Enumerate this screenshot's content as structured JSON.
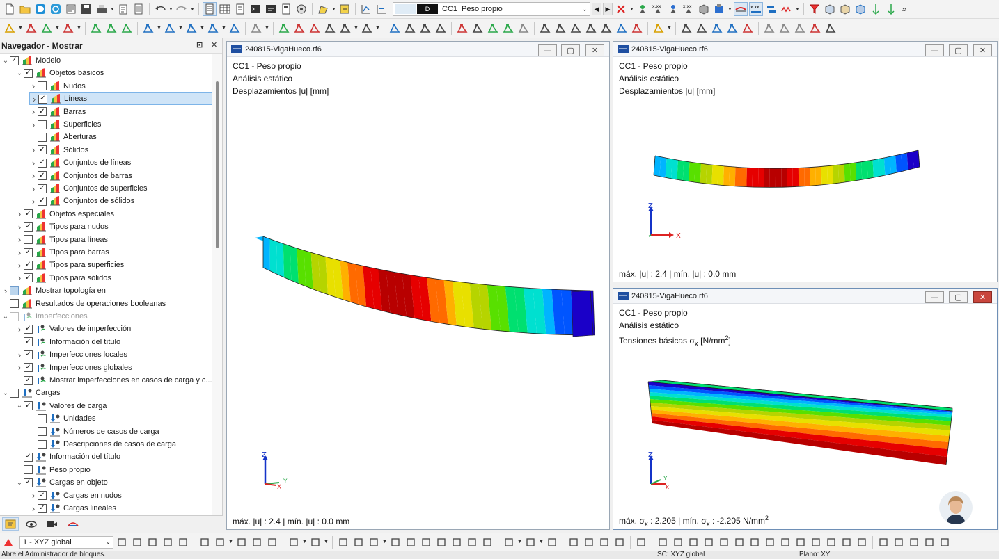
{
  "toolbar": {
    "load_case": {
      "tag": "D",
      "id": "CC1",
      "name": "Peso propio"
    }
  },
  "navigator": {
    "title": "Navegador - Mostrar",
    "items": [
      {
        "label": "Modelo",
        "level": 0,
        "expand": "open",
        "check": "checked",
        "icon": "model"
      },
      {
        "label": "Objetos básicos",
        "level": 1,
        "expand": "open",
        "check": "checked",
        "icon": "model"
      },
      {
        "label": "Nudos",
        "level": 2,
        "expand": "closed",
        "check": "unchecked",
        "icon": "model"
      },
      {
        "label": "Líneas",
        "level": 2,
        "expand": "closed",
        "check": "checked",
        "icon": "model",
        "selected": true
      },
      {
        "label": "Barras",
        "level": 2,
        "expand": "closed",
        "check": "checked",
        "icon": "model"
      },
      {
        "label": "Superficies",
        "level": 2,
        "expand": "closed",
        "check": "unchecked",
        "icon": "model"
      },
      {
        "label": "Aberturas",
        "level": 2,
        "expand": "none",
        "check": "unchecked",
        "icon": "model"
      },
      {
        "label": "Sólidos",
        "level": 2,
        "expand": "closed",
        "check": "checked",
        "icon": "model"
      },
      {
        "label": "Conjuntos de líneas",
        "level": 2,
        "expand": "closed",
        "check": "checked",
        "icon": "model"
      },
      {
        "label": "Conjuntos de barras",
        "level": 2,
        "expand": "closed",
        "check": "checked",
        "icon": "model"
      },
      {
        "label": "Conjuntos de superficies",
        "level": 2,
        "expand": "closed",
        "check": "checked",
        "icon": "model"
      },
      {
        "label": "Conjuntos de sólidos",
        "level": 2,
        "expand": "closed",
        "check": "checked",
        "icon": "model"
      },
      {
        "label": "Objetos especiales",
        "level": 1,
        "expand": "closed",
        "check": "checked",
        "icon": "model"
      },
      {
        "label": "Tipos para nudos",
        "level": 1,
        "expand": "closed",
        "check": "checked",
        "icon": "model"
      },
      {
        "label": "Tipos para líneas",
        "level": 1,
        "expand": "closed",
        "check": "unchecked",
        "icon": "model"
      },
      {
        "label": "Tipos para barras",
        "level": 1,
        "expand": "closed",
        "check": "checked",
        "icon": "model"
      },
      {
        "label": "Tipos para superficies",
        "level": 1,
        "expand": "closed",
        "check": "checked",
        "icon": "model"
      },
      {
        "label": "Tipos para sólidos",
        "level": 1,
        "expand": "closed",
        "check": "checked",
        "icon": "model"
      },
      {
        "label": "Mostrar topología en",
        "level": 0,
        "expand": "closed",
        "check": "partial",
        "icon": "model"
      },
      {
        "label": "Resultados de operaciones booleanas",
        "level": 0,
        "expand": "none",
        "check": "unchecked",
        "icon": "model"
      },
      {
        "label": "Imperfecciones",
        "level": 0,
        "expand": "open",
        "check": "disabled",
        "icon": "imperf",
        "dim": true
      },
      {
        "label": "Valores de imperfección",
        "level": 1,
        "expand": "closed",
        "check": "checked",
        "icon": "imperf"
      },
      {
        "label": "Información del título",
        "level": 1,
        "expand": "none",
        "check": "checked",
        "icon": "imperf"
      },
      {
        "label": "Imperfecciones locales",
        "level": 1,
        "expand": "closed",
        "check": "checked",
        "icon": "imperf"
      },
      {
        "label": "Imperfecciones globales",
        "level": 1,
        "expand": "closed",
        "check": "checked",
        "icon": "imperf"
      },
      {
        "label": "Mostrar imperfecciones en casos de carga y c...",
        "level": 1,
        "expand": "none",
        "check": "checked",
        "icon": "imperf"
      },
      {
        "label": "Cargas",
        "level": 0,
        "expand": "open",
        "check": "unchecked",
        "icon": "load"
      },
      {
        "label": "Valores de carga",
        "level": 1,
        "expand": "open",
        "check": "checked",
        "icon": "load"
      },
      {
        "label": "Unidades",
        "level": 2,
        "expand": "none",
        "check": "unchecked",
        "icon": "load"
      },
      {
        "label": "Números de casos de carga",
        "level": 2,
        "expand": "none",
        "check": "unchecked",
        "icon": "load"
      },
      {
        "label": "Descripciones de casos de carga",
        "level": 2,
        "expand": "none",
        "check": "unchecked",
        "icon": "load"
      },
      {
        "label": "Información del título",
        "level": 1,
        "expand": "none",
        "check": "checked",
        "icon": "load"
      },
      {
        "label": "Peso propio",
        "level": 1,
        "expand": "none",
        "check": "unchecked",
        "icon": "load"
      },
      {
        "label": "Cargas en objeto",
        "level": 1,
        "expand": "open",
        "check": "checked",
        "icon": "load"
      },
      {
        "label": "Cargas en nudos",
        "level": 2,
        "expand": "closed",
        "check": "checked",
        "icon": "load"
      },
      {
        "label": "Cargas lineales",
        "level": 2,
        "expand": "closed",
        "check": "checked",
        "icon": "load"
      }
    ]
  },
  "viewports": {
    "left": {
      "title": "240815-VigaHueco.rf6",
      "line1": "CC1 - Peso propio",
      "line2": "Análisis estático",
      "line3": "Desplazamientos |u| [mm]",
      "footer": "máx. |u| : 2.4 | mín. |u| : 0.0 mm"
    },
    "top_right": {
      "title": "240815-VigaHueco.rf6",
      "line1": "CC1 - Peso propio",
      "line2": "Análisis estático",
      "line3": "Desplazamientos |u| [mm]",
      "footer": "máx. |u| : 2.4 | mín. |u| : 0.0 mm"
    },
    "bottom_right": {
      "title": "240815-VigaHueco.rf6",
      "line1": "CC1 - Peso propio",
      "line2": "Análisis estático",
      "line3_prefix": "Tensiones básicas ",
      "line3_sigma": "σ",
      "line3_sub": "x",
      "line3_unit": " [N/mm",
      "line3_sup": "2",
      "line3_close": "]",
      "footer_a": "máx. ",
      "footer_b": "σ",
      "footer_c": "x",
      "footer_d": " : 2.205 | mín. ",
      "footer_e": "σ",
      "footer_f": "x",
      "footer_g": " : -2.205 N/mm",
      "footer_h": "2"
    }
  },
  "axes": {
    "z": "Z",
    "x": "X",
    "y": "Y"
  },
  "bottom_toolbar": {
    "coord_system": "1 - XYZ global"
  },
  "status": {
    "message": "Abre el Administrador de bloques.",
    "cs": "SC: XYZ global",
    "plane": "Plano: XY"
  },
  "colors": {
    "accent": "#1f6fc1",
    "selection": "#cfe4f7",
    "close_red": "#c9463d",
    "contour": [
      "#1a00c8",
      "#0055ff",
      "#00b4ff",
      "#00e0d0",
      "#00e070",
      "#58e000",
      "#b6d400",
      "#e8e000",
      "#ffb000",
      "#ff6a00",
      "#e60000",
      "#b80000"
    ]
  }
}
